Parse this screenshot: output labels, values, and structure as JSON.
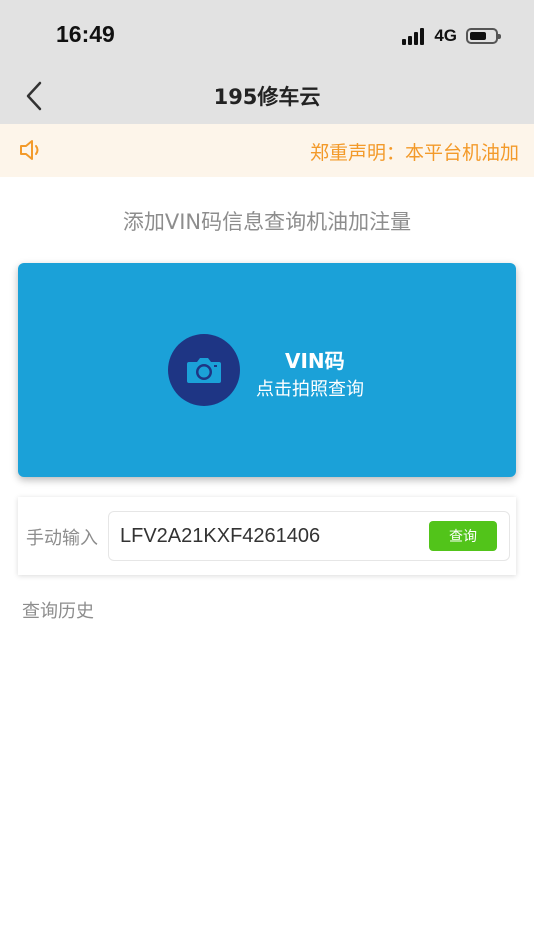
{
  "status_bar": {
    "time": "16:49",
    "network": "4G",
    "signal_icon": "signal-bars-icon",
    "battery_icon": "battery-icon",
    "battery_level": 0.6
  },
  "nav": {
    "title": "195修车云",
    "back_icon": "chevron-left-icon"
  },
  "notice": {
    "icon": "speaker-icon",
    "text": "郑重声明：本平台机油加",
    "color": "#f39a2a",
    "background": "#fdf5ea"
  },
  "subtitle": "添加VIN码信息查询机油加注量",
  "vin_card": {
    "icon": "camera-icon",
    "title": "VIN码",
    "subtitle": "点击拍照查询",
    "color": "#1ba1d8",
    "icon_bg": "#1e3584"
  },
  "manual": {
    "label": "手动输入",
    "value": "LFV2A21KXF4261406",
    "button_label": "查询",
    "button_color": "#52c41a"
  },
  "history": {
    "label": "查询历史"
  }
}
